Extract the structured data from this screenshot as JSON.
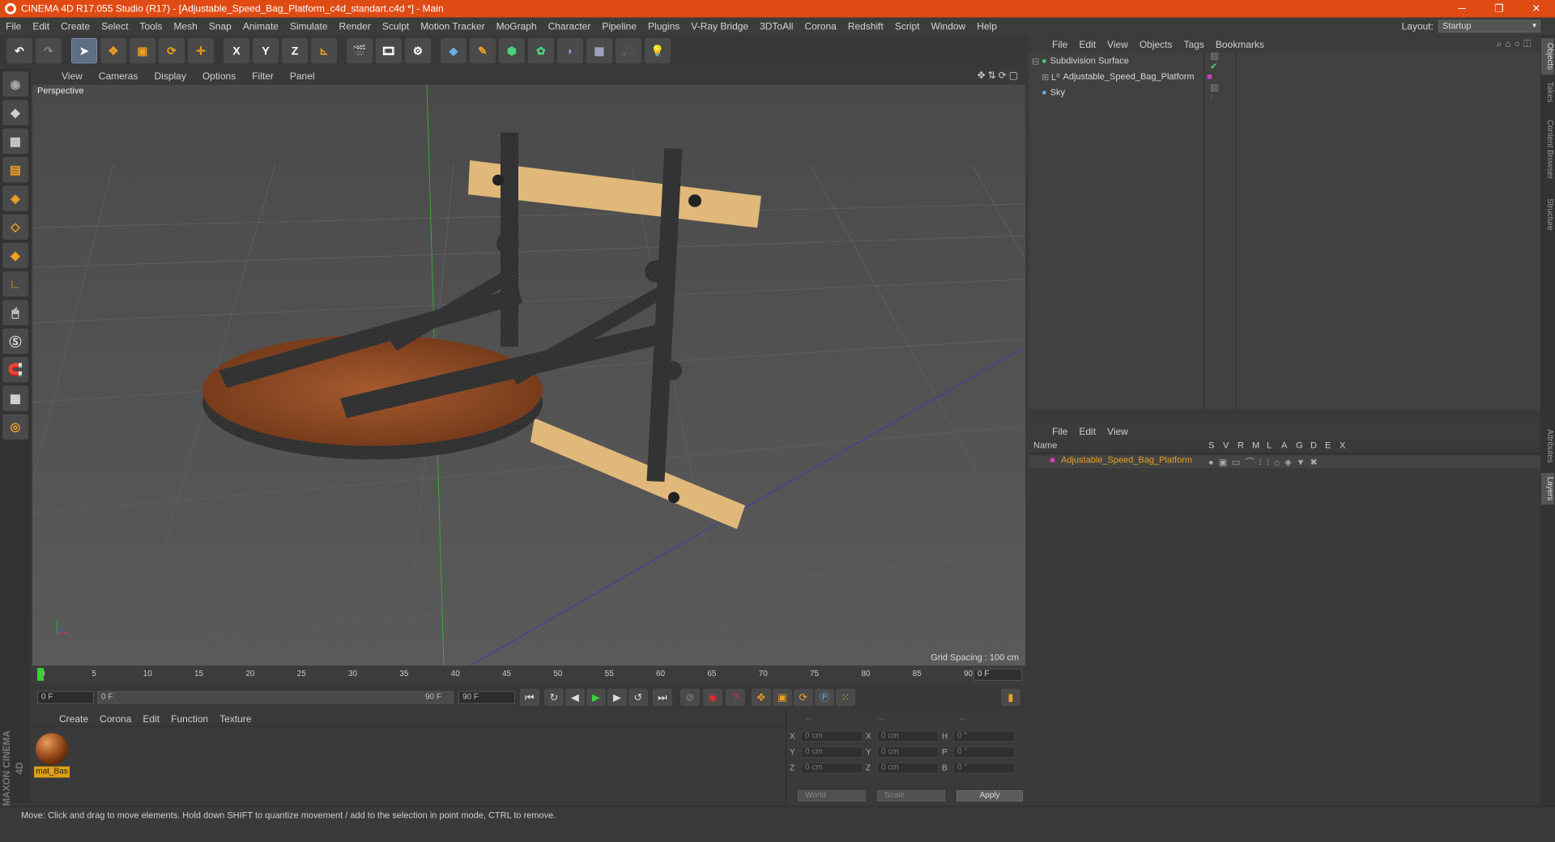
{
  "window": {
    "title": "CINEMA 4D R17.055 Studio (R17) - [Adjustable_Speed_Bag_Platform_c4d_standart.c4d *] - Main",
    "minimize": "─",
    "maximize": "❐",
    "close": "✕"
  },
  "menu": [
    "File",
    "Edit",
    "Create",
    "Select",
    "Tools",
    "Mesh",
    "Snap",
    "Animate",
    "Simulate",
    "Render",
    "Sculpt",
    "Motion Tracker",
    "MoGraph",
    "Character",
    "Pipeline",
    "Plugins",
    "V-Ray Bridge",
    "3DToAll",
    "Corona",
    "Redshift",
    "Script",
    "Window",
    "Help"
  ],
  "layout": {
    "label": "Layout:",
    "value": "Startup"
  },
  "toolbar": {
    "x": "X",
    "y": "Y",
    "z": "Z"
  },
  "viewport": {
    "menu": [
      "View",
      "Cameras",
      "Display",
      "Options",
      "Filter",
      "Panel"
    ],
    "label": "Perspective",
    "grid_spacing": "Grid Spacing : 100 cm"
  },
  "timeline": {
    "ticks": [
      "0",
      "5",
      "10",
      "15",
      "20",
      "25",
      "30",
      "35",
      "40",
      "45",
      "50",
      "55",
      "60",
      "65",
      "70",
      "75",
      "80",
      "85",
      "90"
    ],
    "current": "0 F"
  },
  "transport": {
    "start": "0 F",
    "range_start": "0 F",
    "range_end": "90 F",
    "end": "90 F"
  },
  "material": {
    "menu": [
      "Create",
      "Corona",
      "Edit",
      "Function",
      "Texture"
    ],
    "name": "mat_Bas"
  },
  "coords": {
    "header": [
      "--",
      "--",
      "--"
    ],
    "rows": [
      {
        "a": "X",
        "av": "0 cm",
        "b": "X",
        "bv": "0 cm",
        "c": "H",
        "cv": "0 °"
      },
      {
        "a": "Y",
        "av": "0 cm",
        "b": "Y",
        "bv": "0 cm",
        "c": "P",
        "cv": "0 °"
      },
      {
        "a": "Z",
        "av": "0 cm",
        "b": "Z",
        "bv": "0 cm",
        "c": "B",
        "cv": "0 °"
      }
    ],
    "world": "World",
    "scale": "Scale",
    "apply": "Apply"
  },
  "objects": {
    "menu": [
      "File",
      "Edit",
      "View",
      "Objects",
      "Tags",
      "Bookmarks"
    ],
    "items": [
      "Subdivision Surface",
      "Adjustable_Speed_Bag_Platform",
      "Sky"
    ]
  },
  "layers": {
    "menu": [
      "File",
      "Edit",
      "View"
    ],
    "cols": [
      "Name",
      "S",
      "V",
      "R",
      "M",
      "L",
      "A",
      "G",
      "D",
      "E",
      "X"
    ],
    "item": "Adjustable_Speed_Bag_Platform"
  },
  "sidetabs": [
    "Objects",
    "Takes",
    "Content Browser",
    "Structure",
    "Attributes",
    "Layers"
  ],
  "status": "Move: Click and drag to move elements. Hold down SHIFT to quantize movement / add to the selection in point mode, CTRL to remove.",
  "brand": "MAXON CINEMA 4D",
  "colors": {
    "accent": "#e04b14",
    "layer": "#e6a020",
    "layer_swatch": "#d040c0"
  }
}
